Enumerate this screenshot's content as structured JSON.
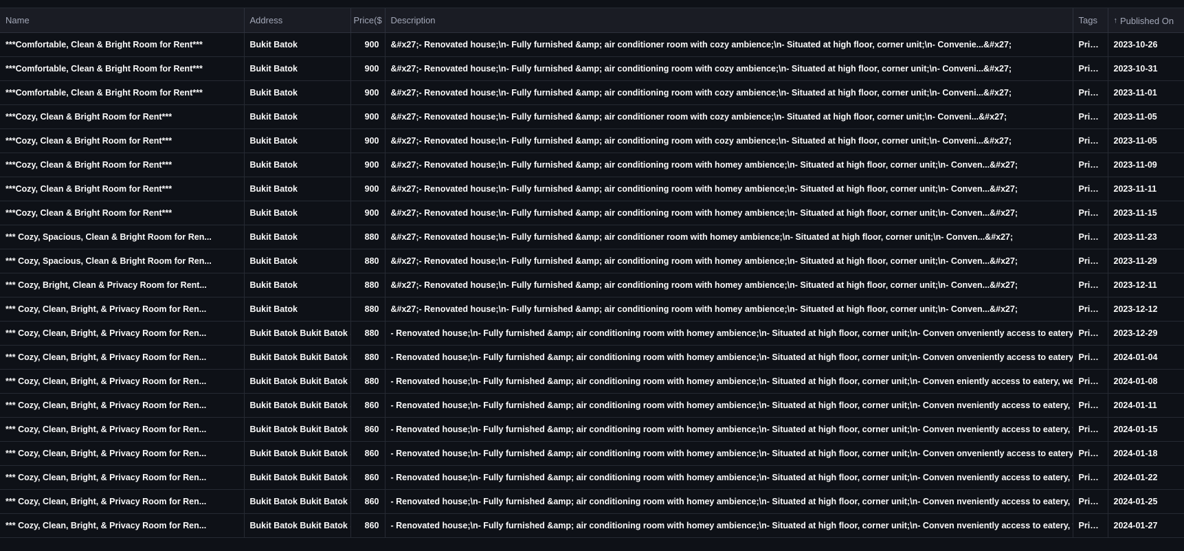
{
  "table": {
    "columns": [
      {
        "key": "name",
        "label": "Name"
      },
      {
        "key": "address",
        "label": "Address"
      },
      {
        "key": "price",
        "label": "Price($"
      },
      {
        "key": "description",
        "label": "Description"
      },
      {
        "key": "tags",
        "label": "Tags"
      },
      {
        "key": "published_on",
        "label": "Published On",
        "sort": "ascending",
        "sort_icon": "arrow-up-icon"
      }
    ],
    "rows": [
      {
        "name": "***Comfortable, Clean & Bright Room for Rent***",
        "address": "Bukit Batok",
        "price": "900",
        "description": "&#x27;- Renovated house;\\n- Fully furnished &amp; air conditioner room with cozy ambience;\\n- Situated at high floor, corner unit;\\n- Convenie...&#x27;",
        "tags": "Private",
        "published_on": "2023-10-26"
      },
      {
        "name": "***Comfortable, Clean & Bright Room for Rent***",
        "address": "Bukit Batok",
        "price": "900",
        "description": "&#x27;- Renovated house;\\n- Fully furnished &amp; air conditioning room with cozy ambience;\\n- Situated at high floor, corner unit;\\n- Conveni...&#x27;",
        "tags": "Private",
        "published_on": "2023-10-31"
      },
      {
        "name": "***Comfortable, Clean & Bright Room for Rent***",
        "address": "Bukit Batok",
        "price": "900",
        "description": "&#x27;- Renovated house;\\n- Fully furnished &amp; air conditioning room with cozy ambience;\\n- Situated at high floor, corner unit;\\n- Conveni...&#x27;",
        "tags": "Private",
        "published_on": "2023-11-01"
      },
      {
        "name": "***Cozy, Clean & Bright Room for Rent***",
        "address": "Bukit Batok",
        "price": "900",
        "description": "&#x27;- Renovated house;\\n- Fully furnished &amp; air conditioner room with cozy ambience;\\n- Situated at high floor, corner unit;\\n- Conveni...&#x27;",
        "tags": "Private",
        "published_on": "2023-11-05"
      },
      {
        "name": "***Cozy, Clean & Bright Room for Rent***",
        "address": "Bukit Batok",
        "price": "900",
        "description": "&#x27;- Renovated house;\\n- Fully furnished &amp; air conditioning room with cozy ambience;\\n- Situated at high floor, corner unit;\\n- Conveni...&#x27;",
        "tags": "Private",
        "published_on": "2023-11-05"
      },
      {
        "name": "***Cozy, Clean & Bright Room for Rent***",
        "address": "Bukit Batok",
        "price": "900",
        "description": "&#x27;- Renovated house;\\n- Fully furnished &amp; air conditioning room with homey ambience;\\n- Situated at high floor, corner unit;\\n- Conven...&#x27;",
        "tags": "Private",
        "published_on": "2023-11-09"
      },
      {
        "name": "***Cozy, Clean & Bright Room for Rent***",
        "address": "Bukit Batok",
        "price": "900",
        "description": "&#x27;- Renovated house;\\n- Fully furnished &amp; air conditioning room with homey ambience;\\n- Situated at high floor, corner unit;\\n- Conven...&#x27;",
        "tags": "Private",
        "published_on": "2023-11-11"
      },
      {
        "name": "***Cozy, Clean & Bright Room for Rent***",
        "address": "Bukit Batok",
        "price": "900",
        "description": "&#x27;- Renovated house;\\n- Fully furnished &amp; air conditioning room with homey ambience;\\n- Situated at high floor, corner unit;\\n- Conven...&#x27;",
        "tags": "Private",
        "published_on": "2023-11-15"
      },
      {
        "name": "*** Cozy, Spacious, Clean & Bright Room for Ren...",
        "address": "Bukit Batok",
        "price": "880",
        "description": "&#x27;- Renovated house;\\n- Fully furnished &amp; air conditioner room with homey ambience;\\n- Situated at high floor, corner unit;\\n- Conven...&#x27;",
        "tags": "Private",
        "published_on": "2023-11-23"
      },
      {
        "name": "*** Cozy, Spacious, Clean & Bright Room for Ren...",
        "address": "Bukit Batok",
        "price": "880",
        "description": "&#x27;- Renovated house;\\n- Fully furnished &amp; air conditioning room with homey ambience;\\n- Situated at high floor, corner unit;\\n- Conven...&#x27;",
        "tags": "Private",
        "published_on": "2023-11-29"
      },
      {
        "name": "*** Cozy, Bright, Clean & Privacy Room for Rent...",
        "address": "Bukit Batok",
        "price": "880",
        "description": "&#x27;- Renovated house;\\n- Fully furnished &amp; air conditioning room with homey ambience;\\n- Situated at high floor, corner unit;\\n- Conven...&#x27;",
        "tags": "Private",
        "published_on": "2023-12-11"
      },
      {
        "name": "*** Cozy, Clean, Bright, & Privacy Room for Ren...",
        "address": "Bukit Batok",
        "price": "880",
        "description": "&#x27;- Renovated house;\\n- Fully furnished &amp; air conditioning room with homey ambience;\\n- Situated at high floor, corner unit;\\n- Conven...&#x27;",
        "tags": "Private",
        "published_on": "2023-12-12"
      },
      {
        "name": "*** Cozy, Clean, Bright, & Privacy Room for Ren...",
        "address": "Bukit Batok Bukit Batok S",
        "price": "880",
        "description": "- Renovated house;\\n- Fully furnished &amp; air conditioning room with homey ambience;\\n- Situated at high floor, corner unit;\\n- Conven onveniently access to eatery, we",
        "tags": "Private",
        "published_on": "2023-12-29"
      },
      {
        "name": "*** Cozy, Clean, Bright, & Privacy Room for Ren...",
        "address": "Bukit Batok Bukit Batok S",
        "price": "880",
        "description": "- Renovated house;\\n- Fully furnished &amp; air conditioning room with homey ambience;\\n- Situated at high floor, corner unit;\\n- Conven onveniently access to eatery, we",
        "tags": "Private",
        "published_on": "2024-01-04"
      },
      {
        "name": "*** Cozy, Clean, Bright, & Privacy Room for Ren...",
        "address": "Bukit Batok Bukit Batok S",
        "price": "880",
        "description": "- Renovated house;\\n- Fully furnished &amp; air conditioning room with homey ambience;\\n- Situated at high floor, corner unit;\\n- Conven eniently access to eatery, wet m",
        "tags": "Private",
        "published_on": "2024-01-08"
      },
      {
        "name": "*** Cozy, Clean, Bright, & Privacy Room for Ren...",
        "address": "Bukit Batok Bukit Batok S",
        "price": "860",
        "description": "- Renovated house;\\n- Fully furnished &amp; air conditioning room with homey ambience;\\n- Situated at high floor, corner unit;\\n- Conven nveniently access to eatery, wet",
        "tags": "Private",
        "published_on": "2024-01-11"
      },
      {
        "name": "*** Cozy, Clean, Bright, & Privacy Room for Ren...",
        "address": "Bukit Batok Bukit Batok S",
        "price": "860",
        "description": "- Renovated house;\\n- Fully furnished &amp; air conditioning room with homey ambience;\\n- Situated at high floor, corner unit;\\n- Conven nveniently access to eatery, wet",
        "tags": "Private",
        "published_on": "2024-01-15"
      },
      {
        "name": "*** Cozy, Clean, Bright, & Privacy Room for Ren...",
        "address": "Bukit Batok Bukit Batok S",
        "price": "860",
        "description": "- Renovated house;\\n- Fully furnished &amp; air conditioning room with homey ambience;\\n- Situated at high floor, corner unit;\\n- Conven onveniently access to eatery, we",
        "tags": "Private",
        "published_on": "2024-01-18"
      },
      {
        "name": "*** Cozy, Clean, Bright, & Privacy Room for Ren...",
        "address": "Bukit Batok Bukit Batok S",
        "price": "860",
        "description": "- Renovated house;\\n- Fully furnished &amp; air conditioning room with homey ambience;\\n- Situated at high floor, corner unit;\\n- Conven nveniently access to eatery, wet",
        "tags": "Private",
        "published_on": "2024-01-22"
      },
      {
        "name": "*** Cozy, Clean, Bright, & Privacy Room for Ren...",
        "address": "Bukit Batok Bukit Batok S",
        "price": "860",
        "description": "- Renovated house;\\n- Fully furnished &amp; air conditioning room with homey ambience;\\n- Situated at high floor, corner unit;\\n- Conven nveniently access to eatery, wet",
        "tags": "Private",
        "published_on": "2024-01-25"
      },
      {
        "name": "*** Cozy, Clean, Bright, & Privacy Room for Ren...",
        "address": "Bukit Batok Bukit Batok S",
        "price": "860",
        "description": "- Renovated house;\\n- Fully furnished &amp; air conditioning room with homey ambience;\\n- Situated at high floor, corner unit;\\n- Conven nveniently access to eatery, wet",
        "tags": "Private",
        "published_on": "2024-01-27"
      }
    ]
  },
  "colors": {
    "background": "#0e1117",
    "header_background": "#1a1c24",
    "header_text": "#a3a8b8",
    "cell_text": "#fafafa",
    "grid_line": "#262a33"
  }
}
